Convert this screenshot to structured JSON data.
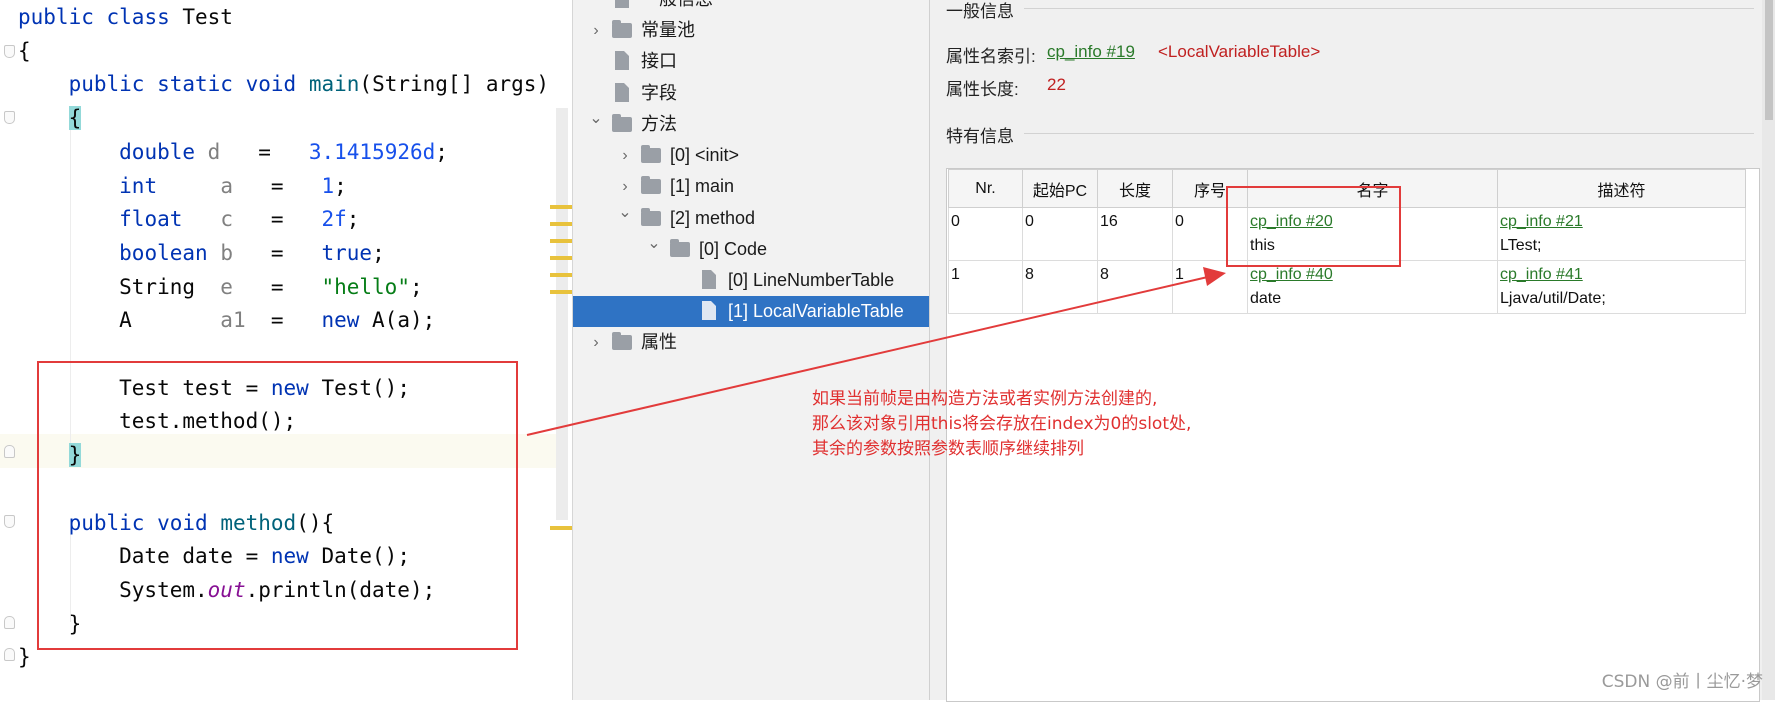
{
  "editor": {
    "lines": [
      {
        "tokens": [
          {
            "t": "public",
            "c": "kw"
          },
          {
            "t": " "
          },
          {
            "t": "class",
            "c": "kw"
          },
          {
            "t": " Test"
          }
        ]
      },
      {
        "tokens": [
          {
            "t": "{"
          }
        ]
      },
      {
        "tokens": [
          {
            "t": "    "
          },
          {
            "t": "public",
            "c": "kw"
          },
          {
            "t": " "
          },
          {
            "t": "static",
            "c": "kw"
          },
          {
            "t": " "
          },
          {
            "t": "void",
            "c": "kw"
          },
          {
            "t": " "
          },
          {
            "t": "main",
            "c": "fn"
          },
          {
            "t": "(String[] args)"
          }
        ]
      },
      {
        "tokens": [
          {
            "t": "    "
          },
          {
            "t": "{",
            "c": "brace-hl"
          }
        ]
      },
      {
        "tokens": [
          {
            "t": "        "
          },
          {
            "t": "double",
            "c": "kw"
          },
          {
            "t": " "
          },
          {
            "t": "d",
            "c": "var"
          },
          {
            "t": "   =   "
          },
          {
            "t": "3.1415926d",
            "c": "num"
          },
          {
            "t": ";"
          }
        ]
      },
      {
        "tokens": [
          {
            "t": "        "
          },
          {
            "t": "int",
            "c": "kw"
          },
          {
            "t": "     "
          },
          {
            "t": "a",
            "c": "var"
          },
          {
            "t": "   =   "
          },
          {
            "t": "1",
            "c": "num"
          },
          {
            "t": ";"
          }
        ]
      },
      {
        "tokens": [
          {
            "t": "        "
          },
          {
            "t": "float",
            "c": "kw"
          },
          {
            "t": "   "
          },
          {
            "t": "c",
            "c": "var"
          },
          {
            "t": "   =   "
          },
          {
            "t": "2f",
            "c": "num"
          },
          {
            "t": ";"
          }
        ]
      },
      {
        "tokens": [
          {
            "t": "        "
          },
          {
            "t": "boolean",
            "c": "kw"
          },
          {
            "t": " "
          },
          {
            "t": "b",
            "c": "var"
          },
          {
            "t": "   =   "
          },
          {
            "t": "true",
            "c": "kw"
          },
          {
            "t": ";"
          }
        ]
      },
      {
        "tokens": [
          {
            "t": "        String  "
          },
          {
            "t": "e",
            "c": "var"
          },
          {
            "t": "   =   "
          },
          {
            "t": "\"hello\"",
            "c": "str"
          },
          {
            "t": ";"
          }
        ]
      },
      {
        "tokens": [
          {
            "t": "        A       "
          },
          {
            "t": "a1",
            "c": "var"
          },
          {
            "t": "  =   "
          },
          {
            "t": "new",
            "c": "kw"
          },
          {
            "t": " A(a);"
          }
        ]
      },
      {
        "tokens": []
      },
      {
        "tokens": [
          {
            "t": "        Test test = "
          },
          {
            "t": "new",
            "c": "kw"
          },
          {
            "t": " Test();"
          }
        ]
      },
      {
        "tokens": [
          {
            "t": "        test.method();"
          }
        ]
      },
      {
        "tokens": [
          {
            "t": "    "
          },
          {
            "t": "}",
            "c": "brace-hl"
          }
        ]
      },
      {
        "tokens": []
      },
      {
        "tokens": [
          {
            "t": "    "
          },
          {
            "t": "public",
            "c": "kw"
          },
          {
            "t": " "
          },
          {
            "t": "void",
            "c": "kw"
          },
          {
            "t": " "
          },
          {
            "t": "method",
            "c": "fn"
          },
          {
            "t": "(){"
          }
        ]
      },
      {
        "tokens": [
          {
            "t": "        Date date = "
          },
          {
            "t": "new",
            "c": "kw"
          },
          {
            "t": " Date();"
          }
        ]
      },
      {
        "tokens": [
          {
            "t": "        System."
          },
          {
            "t": "out",
            "c": "fld"
          },
          {
            "t": ".println(date);"
          }
        ]
      },
      {
        "tokens": [
          {
            "t": "    }"
          }
        ]
      },
      {
        "tokens": [
          {
            "t": "}"
          }
        ]
      }
    ]
  },
  "tree": {
    "items": [
      {
        "label": "一般信息",
        "icon": "file-icon",
        "toggle": ""
      },
      {
        "label": "常量池",
        "icon": "folder-icon",
        "toggle": "chevron-right"
      },
      {
        "label": "接口",
        "icon": "file-icon",
        "toggle": ""
      },
      {
        "label": "字段",
        "icon": "file-icon",
        "toggle": ""
      },
      {
        "label": "方法",
        "icon": "folder-icon",
        "toggle": "chevron-down"
      },
      {
        "label": "[0] <init>",
        "icon": "folder-icon",
        "toggle": "chevron-right"
      },
      {
        "label": "[1] main",
        "icon": "folder-icon",
        "toggle": "chevron-right"
      },
      {
        "label": "[2] method",
        "icon": "folder-icon",
        "toggle": "chevron-down"
      },
      {
        "label": "[0] Code",
        "icon": "folder-icon",
        "toggle": "chevron-down"
      },
      {
        "label": "[0] LineNumberTable",
        "icon": "file-icon",
        "toggle": ""
      },
      {
        "label": "[1] LocalVariableTable",
        "icon": "file-icon",
        "toggle": "",
        "selected": true
      },
      {
        "label": "属性",
        "icon": "folder-icon",
        "toggle": "chevron-right"
      }
    ]
  },
  "detail": {
    "general_title": "一般信息",
    "name_index_label": "属性名索引:",
    "name_index_link": "cp_info #19",
    "name_index_value": "<LocalVariableTable>",
    "length_label": "属性长度:",
    "length_value": "22",
    "specific_title": "特有信息",
    "table": {
      "headers": [
        "Nr.",
        "起始PC",
        "长度",
        "序号",
        "名字",
        "描述符"
      ],
      "rows": [
        {
          "nr": "0",
          "start_pc": "0",
          "length": "16",
          "index": "0",
          "name_link": "cp_info #20",
          "name": "this",
          "desc_link": "cp_info #21",
          "desc": "LTest;"
        },
        {
          "nr": "1",
          "start_pc": "8",
          "length": "8",
          "index": "1",
          "name_link": "cp_info #40",
          "name": "date",
          "desc_link": "cp_info #41",
          "desc": "Ljava/util/Date;"
        }
      ]
    }
  },
  "annotation": {
    "lines": [
      "如果当前帧是由构造方法或者实例方法创建的,",
      "那么该对象引用this将会存放在index为0的slot处,",
      "其余的参数按照参数表顺序继续排列"
    ],
    "color": "#e03030"
  },
  "watermark": "CSDN @前丨尘忆·梦"
}
